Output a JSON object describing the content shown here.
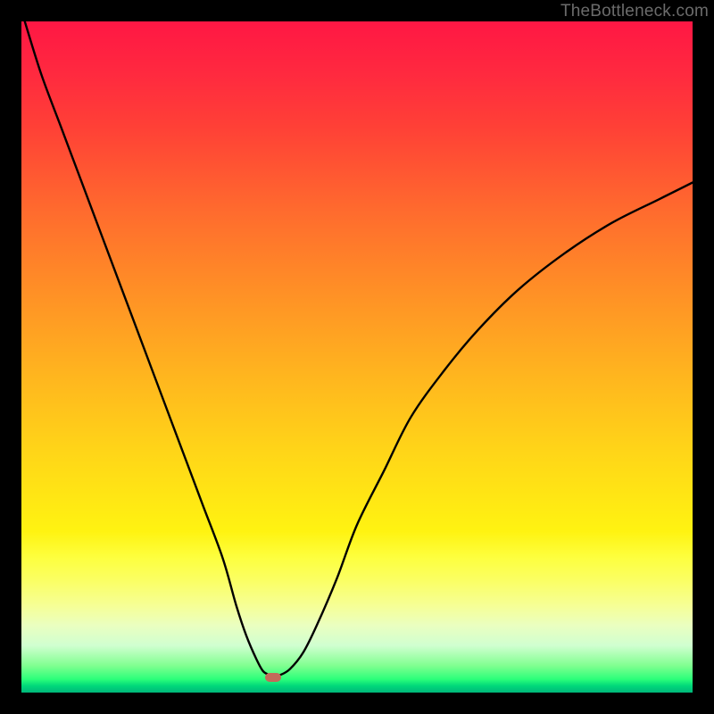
{
  "watermark": "TheBottleneck.com",
  "marker": {
    "x_pct": 37.5,
    "y_pct": 97.8
  },
  "chart_data": {
    "type": "line",
    "title": "",
    "xlabel": "",
    "ylabel": "",
    "xlim": [
      0,
      100
    ],
    "ylim": [
      0,
      100
    ],
    "x": [
      0.5,
      3,
      6,
      9,
      12,
      15,
      18,
      21,
      24,
      27,
      30,
      32,
      33.5,
      35,
      36,
      37,
      37.5,
      38.5,
      40,
      42,
      44,
      47,
      50,
      54,
      58,
      63,
      68,
      74,
      81,
      88,
      95,
      100
    ],
    "y": [
      100,
      92,
      84,
      76,
      68,
      60,
      52,
      44,
      36,
      28,
      20,
      13,
      8.5,
      5,
      3.2,
      2.6,
      2.4,
      2.6,
      3.5,
      6,
      10,
      17,
      25,
      33,
      41,
      48,
      54,
      60,
      65.5,
      70,
      73.5,
      76
    ],
    "series": [
      {
        "name": "curve",
        "values": "see x/y arrays"
      }
    ]
  },
  "colors": {
    "background": "#000000",
    "curve": "#000000",
    "marker": "#c46a5a"
  }
}
